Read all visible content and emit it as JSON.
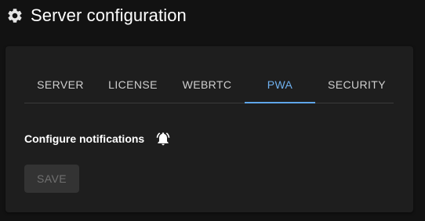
{
  "header": {
    "icon": "gear-icon",
    "title": "Server configuration"
  },
  "tabs": [
    {
      "label": "SERVER",
      "active": false
    },
    {
      "label": "LICENSE",
      "active": false
    },
    {
      "label": "WEBRTC",
      "active": false
    },
    {
      "label": "PWA",
      "active": true
    },
    {
      "label": "SECURITY",
      "active": false
    }
  ],
  "pwa": {
    "notifications_label": "Configure notifications",
    "notifications_icon": "bell-ringing-icon",
    "save_label": "SAVE",
    "save_disabled": true
  },
  "colors": {
    "background": "#121212",
    "card": "#1e1e1e",
    "accent": "#5fa6ea",
    "text": "#ffffff",
    "tab_text": "#cfcfcf"
  }
}
